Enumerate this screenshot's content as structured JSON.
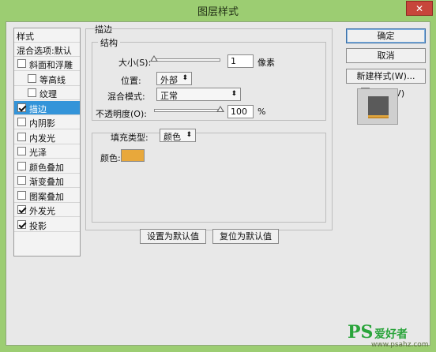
{
  "window": {
    "title": "图层样式",
    "close_label": "✕"
  },
  "style_list": {
    "header": "样式",
    "blend_options": "混合选项:默认",
    "items": [
      {
        "label": "斜面和浮雕",
        "checked": false,
        "indent": false
      },
      {
        "label": "等高线",
        "checked": false,
        "indent": true
      },
      {
        "label": "纹理",
        "checked": false,
        "indent": true
      },
      {
        "label": "描边",
        "checked": true,
        "indent": false,
        "selected": true
      },
      {
        "label": "内阴影",
        "checked": false,
        "indent": false
      },
      {
        "label": "内发光",
        "checked": false,
        "indent": false
      },
      {
        "label": "光泽",
        "checked": false,
        "indent": false
      },
      {
        "label": "颜色叠加",
        "checked": false,
        "indent": false
      },
      {
        "label": "渐变叠加",
        "checked": false,
        "indent": false
      },
      {
        "label": "图案叠加",
        "checked": false,
        "indent": false
      },
      {
        "label": "外发光",
        "checked": true,
        "indent": false
      },
      {
        "label": "投影",
        "checked": true,
        "indent": false
      }
    ]
  },
  "stroke_panel": {
    "title": "描边",
    "structure": {
      "legend": "结构",
      "size_label": "大小(S):",
      "size_value": "1",
      "size_unit": "像素",
      "size_slider_fraction": 0.0,
      "position_label": "位置:",
      "position_value": "外部",
      "blend_label": "混合模式:",
      "blend_value": "正常",
      "opacity_label": "不透明度(O):",
      "opacity_value": "100",
      "opacity_unit": "%",
      "opacity_slider_fraction": 1.0
    },
    "fill": {
      "fill_type_label": "填充类型:",
      "fill_type_value": "颜色",
      "color_label": "颜色:",
      "color": "#e8a83b"
    },
    "set_default_label": "设置为默认值",
    "reset_default_label": "复位为默认值"
  },
  "buttons": {
    "ok": "确定",
    "cancel": "取消",
    "new_style": "新建样式(W)...",
    "preview_label": "预览(V)",
    "preview_checked": true
  },
  "watermark": {
    "main": "PS",
    "cn": "爱好者",
    "url": "www.psahz.com"
  },
  "colors": {
    "frame": "#9ccd72",
    "selected": "#3394d9",
    "stroke": "#e8a83b"
  }
}
